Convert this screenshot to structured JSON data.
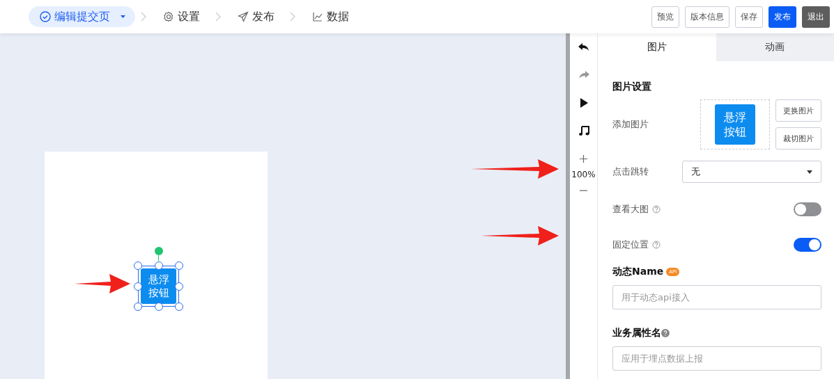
{
  "nav": {
    "steps": [
      {
        "label": "编辑提交页",
        "selected": true
      },
      {
        "label": "设置",
        "selected": false
      },
      {
        "label": "发布",
        "selected": false
      },
      {
        "label": "数据",
        "selected": false
      }
    ]
  },
  "actions": [
    {
      "label": "预览",
      "kind": "outline"
    },
    {
      "label": "版本信息",
      "kind": "outline"
    },
    {
      "label": "保存",
      "kind": "outline"
    },
    {
      "label": "发布",
      "kind": "primary"
    },
    {
      "label": "退出",
      "kind": "dark"
    }
  ],
  "canvas": {
    "element_text": "悬浮按钮"
  },
  "toolbar": {
    "tools": [
      {
        "disabled": false
      },
      {
        "disabled": true
      },
      {
        "disabled": false
      },
      {
        "disabled": false
      }
    ],
    "zoom": "100%"
  },
  "panel": {
    "tabs": [
      {
        "label": "图片",
        "selected": true
      },
      {
        "label": "动画",
        "selected": false
      }
    ],
    "section_title": "图片设置",
    "image": {
      "label": "添加图片",
      "preview_text": "悬浮按钮",
      "buttons": [
        "更换图片",
        "裁切图片"
      ]
    },
    "jump": {
      "label": "点击跳转",
      "value": "无"
    },
    "switches": [
      {
        "label": "查看大图",
        "on": false
      },
      {
        "label": "固定位置",
        "on": true
      }
    ],
    "dynamic_name": {
      "label": "动态Name",
      "badge": "API",
      "placeholder": "用于动态api接入"
    },
    "business": {
      "label": "业务属性名",
      "placeholder": "应用于埋点数据上报"
    }
  }
}
